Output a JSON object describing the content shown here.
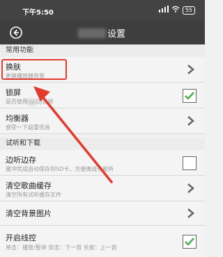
{
  "status": {
    "time": "下午5:50",
    "battery": "55"
  },
  "header": {
    "title": "设置"
  },
  "sections": [
    {
      "label": "常用功能"
    },
    {
      "label": "试听和下载"
    }
  ],
  "rows": [
    {
      "title": "换肤",
      "subtitle": "更换播放器背景",
      "control": "chevron"
    },
    {
      "title": "锁屏",
      "subtitle": "是否使用",
      "subtitle_tail": "DJ锁屏",
      "control": "checkbox",
      "checked": true
    },
    {
      "title": "均衡器",
      "subtitle": "感受一下超重低音",
      "control": "chevron"
    },
    {
      "title": "边听边存",
      "subtitle": "缓冲完成自动保存到SD卡，方便离线也能听",
      "control": "checkbox",
      "checked": false
    },
    {
      "title": "清空歌曲缓存",
      "subtitle": "清空所有试听缓存文件",
      "control": "chevron"
    },
    {
      "title": "清空背景图片",
      "subtitle": "",
      "control": "chevron"
    },
    {
      "title": "开启线控",
      "subtitle": "单击：播放/暂停  双击：下一首  长按：上一首",
      "control": "checkbox",
      "checked": true
    }
  ],
  "colors": {
    "accent": "#e23b2e",
    "check": "#4caf50",
    "header": "#3e3e3e"
  }
}
